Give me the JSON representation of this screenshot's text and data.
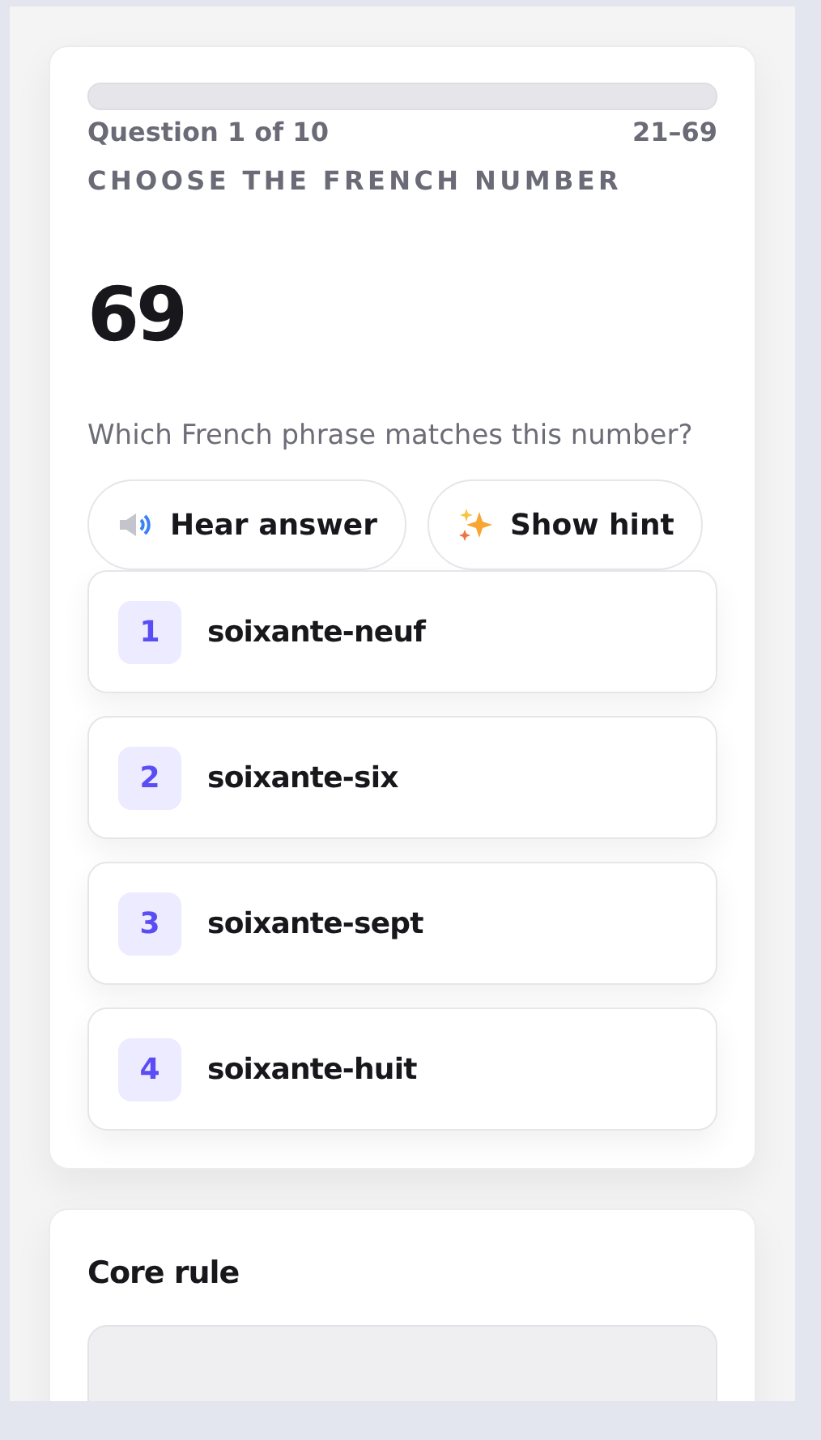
{
  "quiz": {
    "counter": "Question 1 of 10",
    "range": "21–69",
    "instruction": "CHOOSE THE FRENCH NUMBER",
    "number": "69",
    "prompt": "Which French phrase matches this number?",
    "actions": [
      {
        "kind": "audio",
        "label": "Hear answer"
      },
      {
        "kind": "hint",
        "label": "Show hint"
      }
    ],
    "options": [
      {
        "key": "1",
        "text": "soixante-neuf"
      },
      {
        "key": "2",
        "text": "soixante-six"
      },
      {
        "key": "3",
        "text": "soixante-sept"
      },
      {
        "key": "4",
        "text": "soixante-huit"
      }
    ]
  },
  "rule_card": {
    "title": "Core rule"
  }
}
